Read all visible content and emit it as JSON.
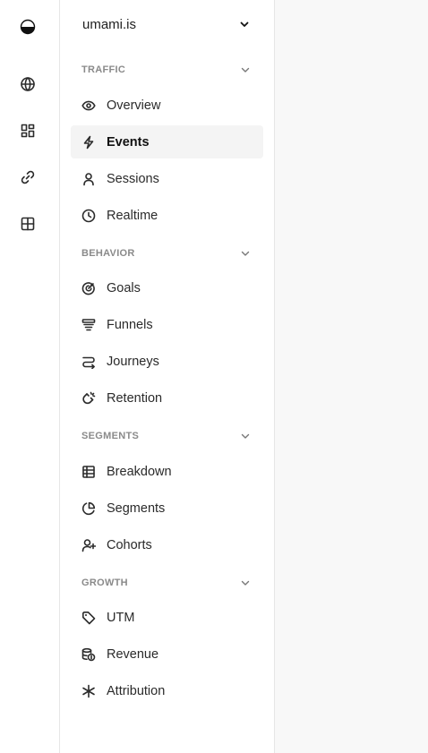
{
  "rail": {
    "items": [
      {
        "name": "logo-icon",
        "icon": "half-circle"
      },
      {
        "name": "globe-icon",
        "icon": "globe"
      },
      {
        "name": "grid-icon",
        "icon": "grid"
      },
      {
        "name": "link-icon",
        "icon": "link"
      },
      {
        "name": "table-icon",
        "icon": "table"
      }
    ]
  },
  "website": {
    "name": "umami.is"
  },
  "sections": {
    "traffic": "TRAFFIC",
    "behavior": "BEHAVIOR",
    "segments": "SEGMENTS",
    "growth": "GROWTH"
  },
  "nav": {
    "overview": "Overview",
    "events": "Events",
    "sessions": "Sessions",
    "realtime": "Realtime",
    "goals": "Goals",
    "funnels": "Funnels",
    "journeys": "Journeys",
    "retention": "Retention",
    "breakdown": "Breakdown",
    "segments": "Segments",
    "cohorts": "Cohorts",
    "utm": "UTM",
    "revenue": "Revenue",
    "attribution": "Attribution"
  },
  "active_item": "Events"
}
